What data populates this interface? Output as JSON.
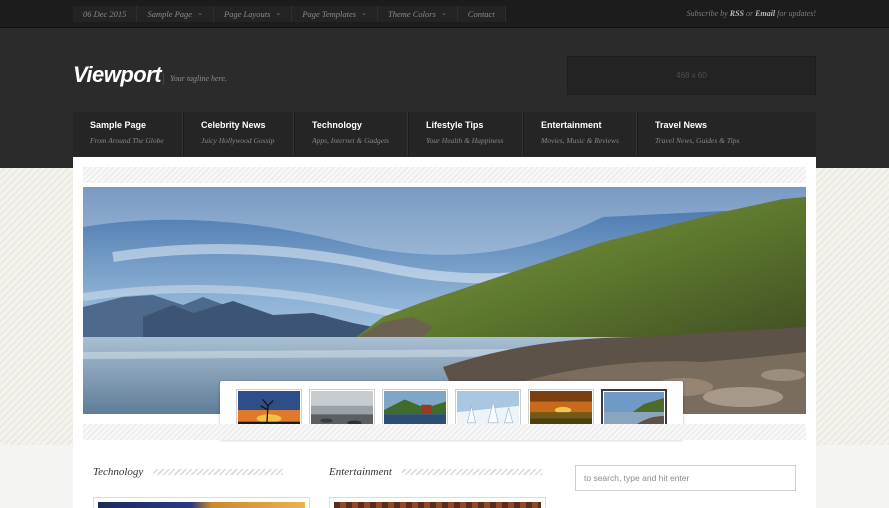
{
  "topbar": {
    "date": "06 Dec 2015",
    "items": [
      {
        "label": "Sample Page",
        "dropdown": true
      },
      {
        "label": "Page Layouts",
        "dropdown": true
      },
      {
        "label": "Page Templates",
        "dropdown": true
      },
      {
        "label": "Theme Colors",
        "dropdown": true
      },
      {
        "label": "Contact",
        "dropdown": false
      }
    ],
    "subscribe": {
      "prefix": "Subscribe by",
      "rss": "RSS",
      "or": "or",
      "email": "Email",
      "suffix": "for updates!"
    }
  },
  "header": {
    "logo": "Viewport",
    "tagline": "Your tagline here.",
    "ad_label": "468 x 60"
  },
  "nav": [
    {
      "title": "Sample Page",
      "subtitle": "From Around The Globe"
    },
    {
      "title": "Celebrity News",
      "subtitle": "Juicy Hollywood Gossip"
    },
    {
      "title": "Technology",
      "subtitle": "Apps, Internet & Gadgets"
    },
    {
      "title": "Lifestyle Tips",
      "subtitle": "Your Health & Happiness"
    },
    {
      "title": "Entertainment",
      "subtitle": "Movies, Music & Reviews"
    },
    {
      "title": "Travel News",
      "subtitle": "Travel News, Guides & Tips"
    }
  ],
  "slider": {
    "active_index": 5,
    "thumbs": [
      "sunset-tree-thumbnail",
      "beach-rocks-thumbnail",
      "lake-cabin-thumbnail",
      "snowy-trees-thumbnail",
      "sunset-field-thumbnail",
      "coastal-cliff-thumbnail"
    ]
  },
  "sections": {
    "left": "Technology",
    "middle": "Entertainment"
  },
  "search": {
    "placeholder": "to search, type and hit enter"
  },
  "colors": {
    "header_bg": "#2b2b2b",
    "topbar_bg": "#1c1c1c",
    "nav_bg": "#252525",
    "panel_bg": "#ffffff"
  }
}
